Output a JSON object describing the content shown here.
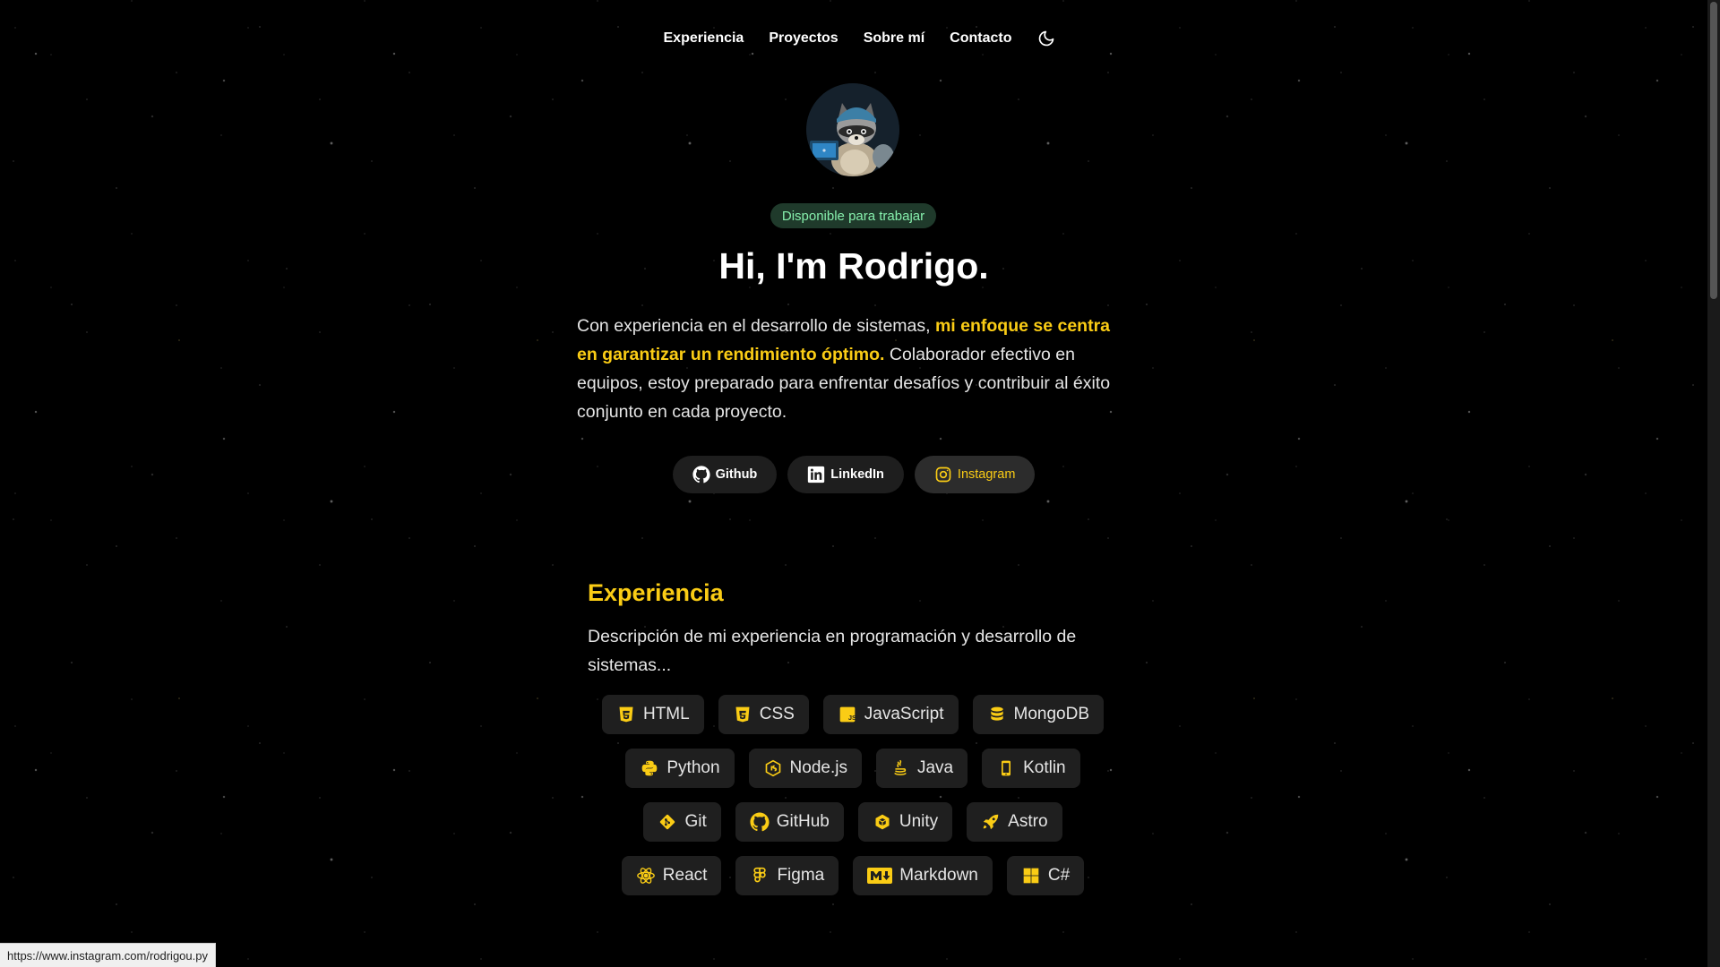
{
  "nav": {
    "items": [
      "Experiencia",
      "Proyectos",
      "Sobre mí",
      "Contacto"
    ],
    "theme_icon": "moon-icon"
  },
  "hero": {
    "badge": "Disponible para trabajar",
    "title": "Hi, I'm Rodrigo.",
    "text_before": "Con experiencia en el desarrollo de sistemas, ",
    "text_highlight": "mi enfoque se centra en garantizar un rendimiento óptimo.",
    "text_after": " Colaborador efectivo en equipos, estoy preparado para enfrentar desafíos y contribuir al éxito conjunto en cada proyecto.",
    "social": [
      {
        "label": "Github",
        "icon": "github-icon"
      },
      {
        "label": "LinkedIn",
        "icon": "linkedin-icon"
      },
      {
        "label": "Instagram",
        "icon": "instagram-icon",
        "active": true
      }
    ]
  },
  "experience": {
    "title": "Experiencia",
    "description": "Descripción de mi experiencia en programación y desarrollo de sistemas...",
    "tags": [
      {
        "label": "HTML",
        "icon": "html5-icon"
      },
      {
        "label": "CSS",
        "icon": "css3-icon"
      },
      {
        "label": "JavaScript",
        "icon": "javascript-icon"
      },
      {
        "label": "MongoDB",
        "icon": "database-icon"
      },
      {
        "label": "Python",
        "icon": "python-icon"
      },
      {
        "label": "Node.js",
        "icon": "nodejs-icon"
      },
      {
        "label": "Java",
        "icon": "java-icon"
      },
      {
        "label": "Kotlin",
        "icon": "mobile-icon"
      },
      {
        "label": "Git",
        "icon": "git-icon"
      },
      {
        "label": "GitHub",
        "icon": "github-icon"
      },
      {
        "label": "Unity",
        "icon": "unity-icon"
      },
      {
        "label": "Astro",
        "icon": "rocket-icon"
      },
      {
        "label": "React",
        "icon": "react-icon"
      },
      {
        "label": "Figma",
        "icon": "figma-icon"
      },
      {
        "label": "Markdown",
        "icon": "markdown-icon"
      },
      {
        "label": "C#",
        "icon": "windows-icon"
      }
    ]
  },
  "status_bar": {
    "url": "https://www.instagram.com/rodrigou.py"
  },
  "colors": {
    "accent": "#facc15",
    "badge_text": "#86efac",
    "badge_bg": "#1f3a2b",
    "background": "#000000"
  }
}
